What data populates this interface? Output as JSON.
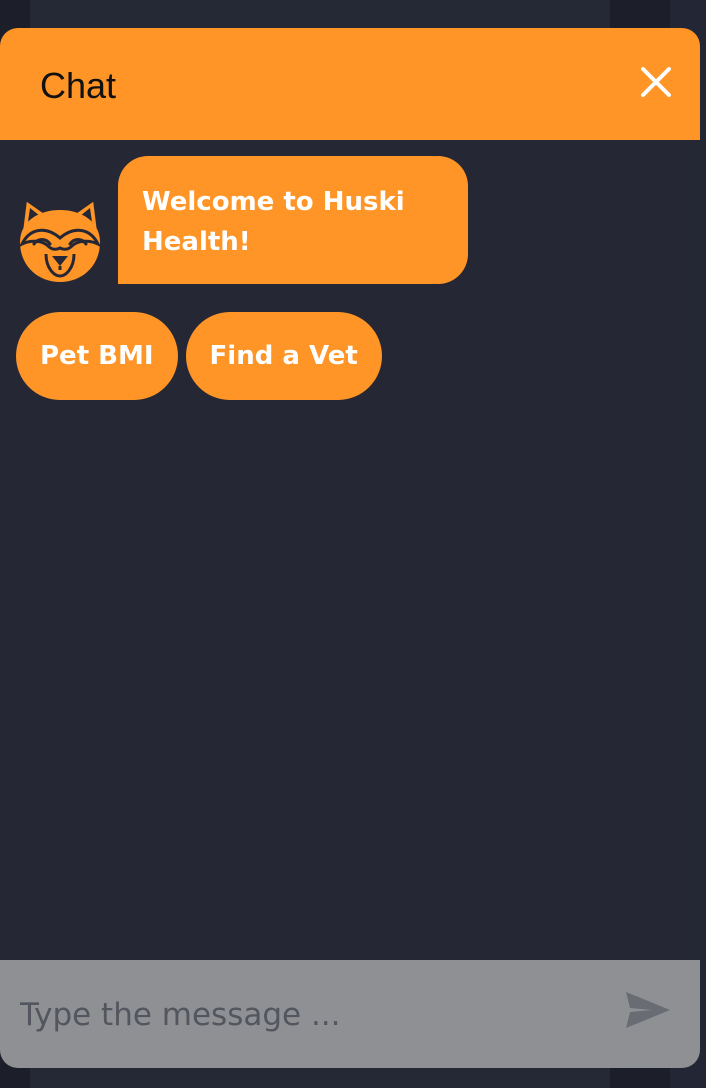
{
  "header": {
    "title": "Chat",
    "close_icon": "close-icon"
  },
  "messages": [
    {
      "sender": "bot",
      "avatar_icon": "husky-dog-icon",
      "text": "Welcome to Huski Health!"
    }
  ],
  "quick_replies": [
    "Pet BMI",
    "Find a Vet"
  ],
  "input": {
    "placeholder": "Type the message ...",
    "value": "",
    "send_icon": "send-icon"
  },
  "colors": {
    "accent": "#ff9526",
    "background": "#252735",
    "input_bar": "#8e9094"
  }
}
